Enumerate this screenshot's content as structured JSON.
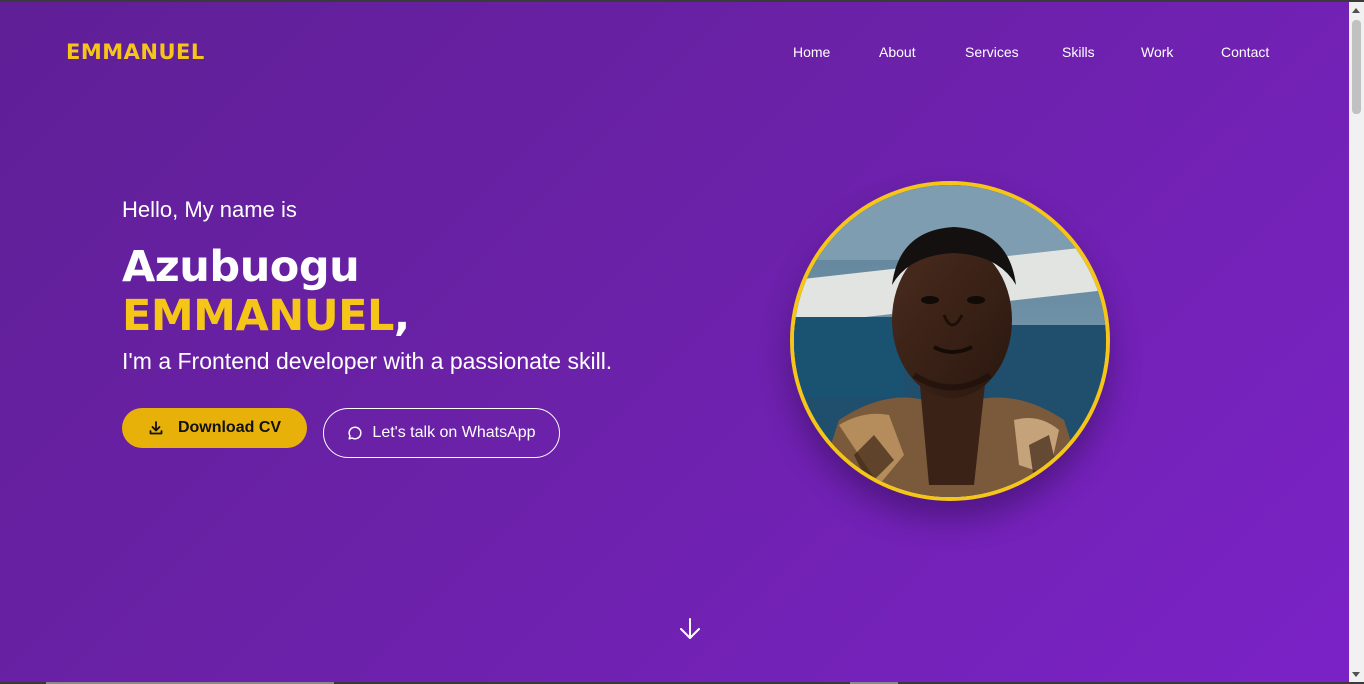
{
  "header": {
    "logo": "EMMANUEL",
    "nav": [
      "Home",
      "About",
      "Services",
      "Skills",
      "Work",
      "Contact"
    ]
  },
  "hero": {
    "greeting": "Hello, My name is",
    "first_name": "Azubuogu",
    "last_name": "EMMANUEL",
    "last_name_suffix": ",",
    "tagline": "I'm a Frontend developer with a passionate skill.",
    "download_button": "Download CV",
    "whatsapp_button": "Let's talk on WhatsApp"
  },
  "icons": {
    "download": "download-icon",
    "whatsapp": "chat-bubble-icon",
    "scroll": "arrow-down-icon"
  },
  "colors": {
    "accent": "#f5c518",
    "button": "#e7b10a",
    "background_start": "#5f1f96",
    "background_end": "#7b22c7"
  }
}
